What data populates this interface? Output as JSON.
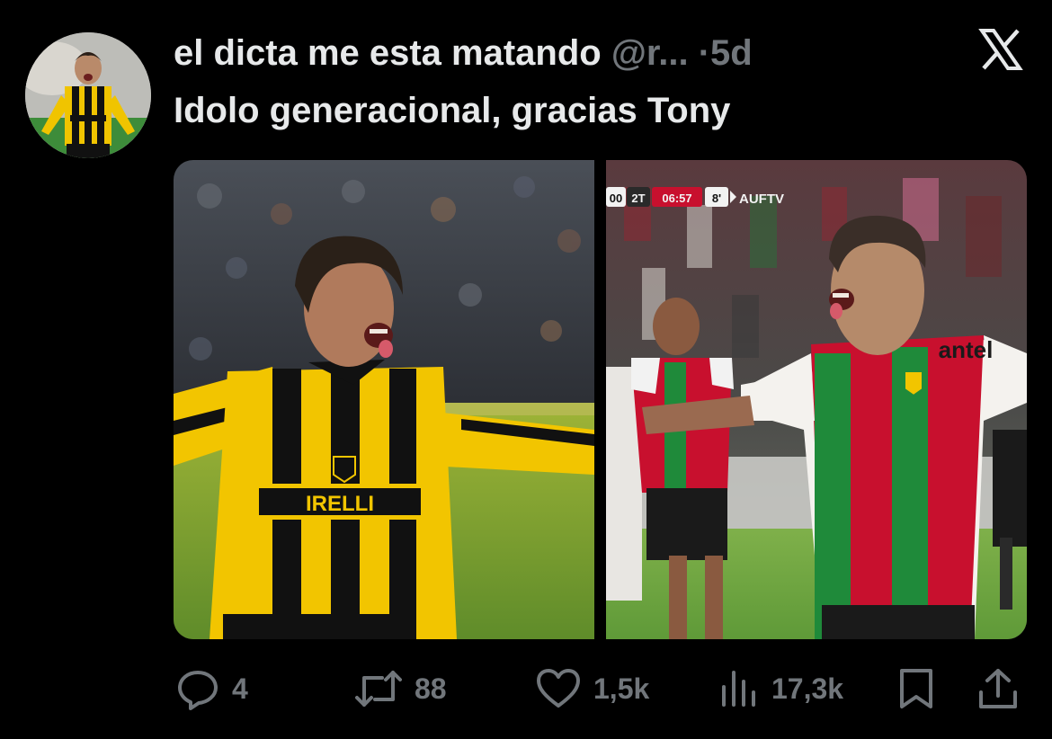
{
  "tweet": {
    "author_name": "el dicta me esta matando",
    "author_handle": "@r...",
    "separator": "·",
    "time": "5d",
    "text": "Idolo generacional, gracias Tony"
  },
  "media": {
    "left_photo": {
      "shirt_sponsor": "IRELLI"
    },
    "right_photo": {
      "scoreboard": {
        "score": "00",
        "half": "2T",
        "clock": "06:57",
        "added": "8'",
        "broadcaster": "AUFTV"
      },
      "shirt_sponsor": "antel"
    }
  },
  "actions": {
    "replies": {
      "icon": "reply-icon",
      "count": "4"
    },
    "retweets": {
      "icon": "retweet-icon",
      "count": "88"
    },
    "likes": {
      "icon": "heart-icon",
      "count": "1,5k"
    },
    "views": {
      "icon": "views-chart-icon",
      "count": "17,3k"
    },
    "bookmark": {
      "icon": "bookmark-icon"
    },
    "share": {
      "icon": "share-icon"
    }
  },
  "colors": {
    "background": "#000000",
    "primary_text": "#e7e9ea",
    "secondary_text": "#71767b",
    "penarol_yellow": "#f2c500",
    "rampla_red": "#c8102e",
    "rampla_green": "#1f8a3a"
  }
}
